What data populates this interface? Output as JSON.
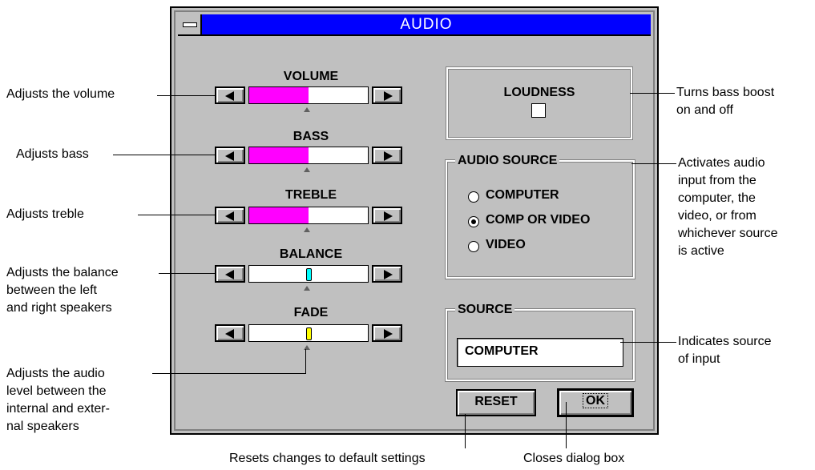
{
  "window": {
    "title": "AUDIO"
  },
  "sliders": [
    {
      "label": "VOLUME",
      "value_fraction": 0.5,
      "indicator": "fill",
      "fill_color": "#ff00ff"
    },
    {
      "label": "BASS",
      "value_fraction": 0.5,
      "indicator": "fill",
      "fill_color": "#ff00ff"
    },
    {
      "label": "TREBLE",
      "value_fraction": 0.5,
      "indicator": "fill",
      "fill_color": "#ff00ff"
    },
    {
      "label": "BALANCE",
      "value_fraction": 0.5,
      "indicator": "knob",
      "knob_color": "#00ffff"
    },
    {
      "label": "FADE",
      "value_fraction": 0.5,
      "indicator": "knob",
      "knob_color": "#ffff00"
    }
  ],
  "loudness": {
    "label": "LOUDNESS",
    "checked": false
  },
  "audio_source": {
    "title": "AUDIO SOURCE",
    "options": [
      "COMPUTER",
      "COMP OR VIDEO",
      "VIDEO"
    ],
    "selected": "COMP OR VIDEO"
  },
  "source": {
    "title": "SOURCE",
    "value": "COMPUTER"
  },
  "buttons": {
    "reset": "RESET",
    "ok": "OK"
  },
  "annotations": {
    "volume": "Adjusts the volume",
    "bass": "Adjusts bass",
    "treble": "Adjusts treble",
    "balance": [
      "Adjusts the balance",
      "between the left",
      "and right speakers"
    ],
    "fade": [
      "Adjusts the audio",
      "level between the",
      "internal and exter-",
      "nal speakers"
    ],
    "loudness": [
      "Turns bass boost",
      "on and off"
    ],
    "audio_source": [
      "Activates audio",
      "input from the",
      "computer, the",
      "video, or from",
      "whichever source",
      "is active"
    ],
    "source": [
      "Indicates source",
      "of input"
    ],
    "reset": "Resets changes to default settings",
    "ok": "Closes dialog box"
  }
}
